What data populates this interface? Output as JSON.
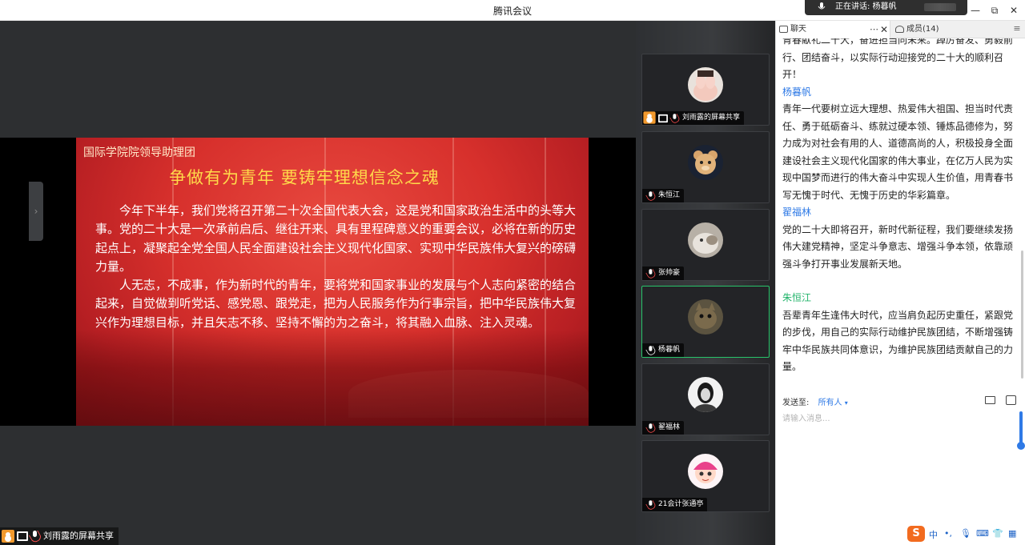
{
  "window": {
    "title": "腾讯会议",
    "speaking_text": "正在讲话: 杨暮帆",
    "min_glyph": "—",
    "restore_glyph": "⧉",
    "close_glyph": "✕"
  },
  "stage": {
    "side_arrow": "›",
    "share_label": "刘雨露的屏幕共享"
  },
  "slide": {
    "org": "国际学院院领导助理团",
    "title": "争做有为青年 要铸牢理想信念之魂",
    "paragraphs": [
      "今年下半年，我们党将召开第二十次全国代表大会，这是党和国家政治生活中的头等大事。党的二十大是一次承前启后、继往开来、具有里程碑意义的重要会议，必将在新的历史起点上，凝聚起全党全国人民全面建设社会主义现代化国家、实现中华民族伟大复兴的磅礴力量。",
      "人无志，不成事，作为新时代的青年，要将党和国家事业的发展与个人志向紧密的结合起来，自觉做到听党话、感党恩、跟党走，把为人民服务作为行事宗旨，把中华民族伟大复兴作为理想目标，并且矢志不移、坚持不懈的为之奋斗，将其融入血脉、注入灵魂。"
    ]
  },
  "participants": [
    {
      "name": "刘雨露的屏幕共享",
      "avatar": "hands-avatar",
      "sharing": true
    },
    {
      "name": "朱恒江",
      "avatar": "teddy-bear-avatar"
    },
    {
      "name": "张帅豪",
      "avatar": "cat-avatar"
    },
    {
      "name": "杨暮帆",
      "avatar": "dark-cat-avatar",
      "active": true
    },
    {
      "name": "翟福林",
      "avatar": "bw-portrait-avatar"
    },
    {
      "name": "21会计张通亭",
      "avatar": "cartoon-avatar"
    }
  ],
  "chat": {
    "tab_chat": "聊天",
    "tab_more": "⋯",
    "tab_close": "✕",
    "tab_members": "成员(14)",
    "menu_glyph": "≡",
    "messages_top": "青春献礼二十大，奋进担当向未来。踔厉奋发、勇毅前行、团结奋斗，以实际行动迎接党的二十大的顺利召开！",
    "messages": [
      {
        "sender": "杨暮帆",
        "text": "青年一代要树立远大理想、热爱伟大祖国、担当时代责任、勇于砥砺奋斗、练就过硬本领、锤炼品德修为，努力成为对社会有用的人、道德高尚的人，积极投身全面建设社会主义现代化国家的伟大事业，在亿万人民为实现中国梦而进行的伟大奋斗中实现人生价值，用青春书写无愧于时代、无愧于历史的华彩篇章。"
      },
      {
        "sender": "翟福林",
        "text": "党的二十大即将召开，新时代新征程，我们要继续发扬伟大建党精神，坚定斗争意志、增强斗争本领，依靠顽强斗争打开事业发展新天地。"
      },
      {
        "sender": "朱恒江",
        "text": "吾辈青年生逢伟大时代，应当肩负起历史重任，紧跟党的步伐，用自己的实际行动维护民族团结，不断增强铸牢中华民族共同体意识，为维护民族团结贡献自己的力量。"
      }
    ],
    "send_to_label": "发送至:",
    "send_to_value": "所有人",
    "send_caret": "▾",
    "input_placeholder": "请输入消息..."
  },
  "ime": {
    "logo": "S",
    "mode": "中",
    "punct": "•,",
    "mic": "🎙",
    "keyboard": "⌨",
    "skin": "👕",
    "apps": "▦"
  },
  "colors": {
    "accent": "#2f7ae6",
    "active_border": "#28c36a",
    "slide_red": "#d7302c",
    "slide_title": "#ffd94a"
  }
}
